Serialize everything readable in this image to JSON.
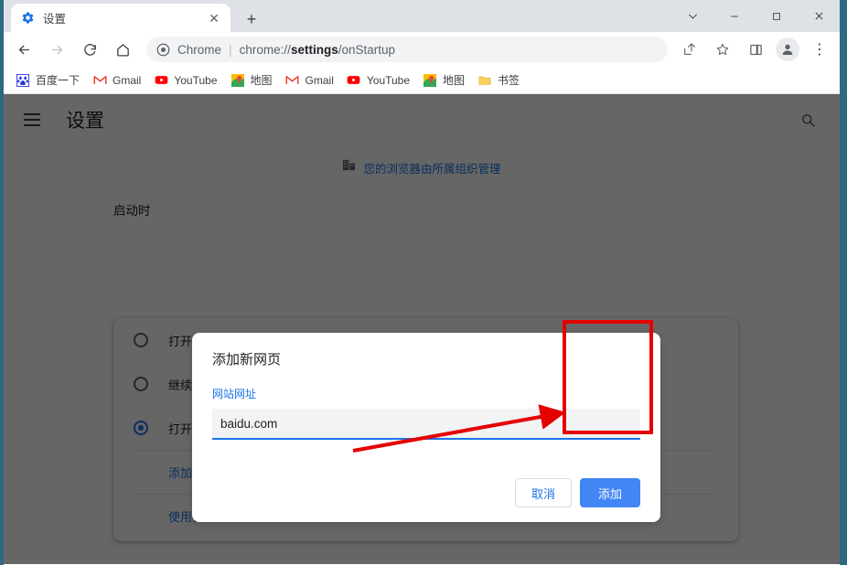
{
  "window": {
    "controls": [
      {
        "name": "minimize-to-tray-button",
        "glyph": "⌄"
      },
      {
        "name": "minimize-button",
        "glyph": "—"
      },
      {
        "name": "maximize-button",
        "glyph": "□"
      },
      {
        "name": "close-button",
        "glyph": "✕"
      }
    ]
  },
  "tabstrip": {
    "tab": {
      "title": "设置",
      "favicon": "gear-icon",
      "close_glyph": "✕"
    },
    "new_tab_glyph": "+"
  },
  "toolbar": {
    "back_glyph": "←",
    "forward_glyph": "→",
    "reload_glyph": "↻",
    "home_glyph": "⌂",
    "omnibox": {
      "chip_label": "Chrome",
      "separator": "|",
      "url_prefix": "chrome://",
      "url_bold": "settings",
      "url_suffix": "/onStartup",
      "full_url": "chrome://settings/onStartup"
    },
    "share_icon": "share-icon",
    "star_icon": "star-icon",
    "sidepanel_icon": "side-panel-icon",
    "profile_icon": "profile-avatar-icon",
    "menu_glyph": "⋮"
  },
  "bookmarks": [
    {
      "label": "百度一下",
      "icon": "baidu-icon"
    },
    {
      "label": "Gmail",
      "icon": "gmail-icon"
    },
    {
      "label": "YouTube",
      "icon": "youtube-icon"
    },
    {
      "label": "地图",
      "icon": "maps-icon"
    },
    {
      "label": "Gmail",
      "icon": "gmail-icon"
    },
    {
      "label": "YouTube",
      "icon": "youtube-icon"
    },
    {
      "label": "地图",
      "icon": "maps-icon"
    },
    {
      "label": "书签",
      "icon": "folder-icon"
    }
  ],
  "settings": {
    "menu_icon": "hamburger-menu-icon",
    "title": "设置",
    "search_icon": "search-icon",
    "managed_notice": {
      "icon": "organization-building-icon",
      "text": "您的浏览器由所属组织管理"
    },
    "section_label": "启动时",
    "startup_options": [
      {
        "label": "打开新标签页",
        "checked": false
      },
      {
        "label": "继续浏览上次打开的网页",
        "checked": false
      },
      {
        "label": "打开特定网页或一组网页",
        "checked": true
      }
    ],
    "add_page_link": "添加新网页",
    "use_current_link": "使用当前网页"
  },
  "dialog": {
    "title": "添加新网页",
    "field_label": "网站网址",
    "input_value": "baidu.com",
    "input_placeholder": "",
    "cancel_label": "取消",
    "confirm_label": "添加"
  },
  "annotation": {
    "highlight_color": "#e50000",
    "shape": "rectangle-and-arrow",
    "target": "confirm-button"
  }
}
